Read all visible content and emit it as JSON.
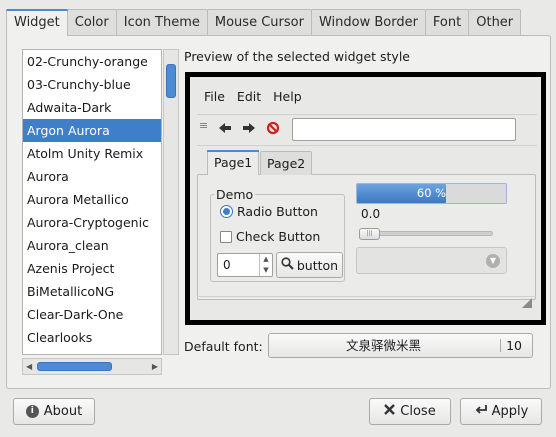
{
  "tabs": [
    {
      "label": "Widget"
    },
    {
      "label": "Color"
    },
    {
      "label": "Icon Theme"
    },
    {
      "label": "Mouse Cursor"
    },
    {
      "label": "Window Border"
    },
    {
      "label": "Font"
    },
    {
      "label": "Other"
    }
  ],
  "themes": [
    {
      "label": "02-Crunchy-orange"
    },
    {
      "label": "03-Crunchy-blue"
    },
    {
      "label": "Adwaita-Dark"
    },
    {
      "label": "Argon Aurora",
      "selected": true
    },
    {
      "label": "Atolm Unity Remix"
    },
    {
      "label": "Aurora"
    },
    {
      "label": "Aurora Metallico"
    },
    {
      "label": "Aurora-Cryptogenic"
    },
    {
      "label": "Aurora_clean"
    },
    {
      "label": "Azenis Project"
    },
    {
      "label": "BiMetallicoNG"
    },
    {
      "label": "Clear-Dark-One"
    },
    {
      "label": "Clearlooks"
    }
  ],
  "preview": {
    "label": "Preview of the selected widget style",
    "menu": [
      "File",
      "Edit",
      "Help"
    ],
    "toolbar_entry_value": "",
    "page_tabs": [
      "Page1",
      "Page2"
    ],
    "demo": {
      "legend": "Demo",
      "radio_label": "Radio Button",
      "check_label": "Check Button",
      "spin_value": "0",
      "button_label": "button"
    },
    "progress": {
      "text": "60 %",
      "fraction": 0.6
    },
    "scale_value": "0.0"
  },
  "default_font": {
    "label": "Default font:",
    "name": "文泉驿微米黑",
    "size": "10"
  },
  "buttons": {
    "about": "About",
    "close": "Close",
    "apply": "Apply"
  },
  "colors": {
    "accent": "#3f7fc9",
    "window_bg": "#e9e9e8"
  },
  "icons": {
    "back": "left-arrow-icon",
    "forward": "right-arrow-icon",
    "stop": "stop-icon",
    "search": "magnifier-icon",
    "about": "info-icon",
    "close": "x-icon",
    "apply": "return-arrow-icon"
  }
}
